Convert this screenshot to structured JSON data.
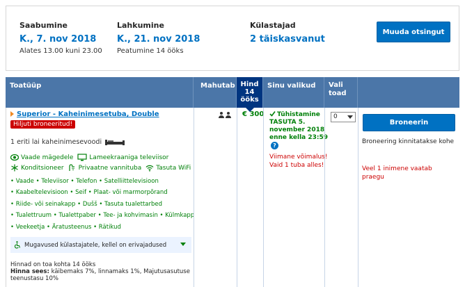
{
  "summary": {
    "checkin_label": "Saabumine",
    "checkin_value": "K., 7. nov 2018",
    "checkin_sub": "Alates 13.00 kuni 23.00",
    "checkout_label": "Lahkumine",
    "checkout_value": "K., 21. nov 2018",
    "checkout_sub": "Peatumine 14 ööks",
    "guests_label": "Külastajad",
    "guests_value": "2 täiskasvanut",
    "modify_button": "Muuda otsingut"
  },
  "table": {
    "headers": {
      "room_type": "Toatüüp",
      "occupancy": "Mahutab",
      "price_line1": "Hind",
      "price_line2": "14",
      "price_line3": "ööks",
      "choices": "Sinu valikud",
      "select_line1": "Vali",
      "select_line2": "toad"
    },
    "room": {
      "name": "Superior - Kaheinimesetuba, Double",
      "badge": "Hiljuti broneeritud!",
      "bed": "1 eriti lai kaheinimesevoodi",
      "features_row1": [
        "Vaade mägedele",
        "Lameekraaniga televiisor"
      ],
      "features_row2": [
        "Konditsioneer",
        "Privaatne vannituba",
        "Tasuta WiFi"
      ],
      "amenity_rows": [
        "• Vaade  • Televiisor  • Telefon  • Satelliittelevisioon",
        "• Kaabeltelevisioon  • Seif  • Plaat- või marmorpõrand",
        "• Riide- või seinakapp  • Dušš  • Tasuta tualettarbed",
        "• Tualettruum  • Tualettpaber  • Tee- ja kohvimasin  • Külmkapp",
        "• Veekeetja  • Äratusteenus  • Rätikud"
      ],
      "accessibility": "Mugavused külastajatele, kellel on erivajadused",
      "price_note_line1": "Hinnad on toa kohta 14 ööks",
      "price_note_label": "Hinna sees:",
      "price_note_rest": " käibemaks 7%, linnamaks 1%, Majutusasutuse teenustasu 10%",
      "price": "€ 300",
      "cancellation": "Tühistamine TASUTA 5. november 2018 enne kella 23:59",
      "last_chance": "Viimane võimalus! Vaid 1 tuba alles!",
      "quantity": "0",
      "book_button": "Broneerin",
      "instant_confirm": "Broneering kinnitatakse kohe",
      "viewers": "Veel 1 inimene vaatab praegu"
    }
  },
  "colors": {
    "brand_blue": "#0071c2",
    "header_blue": "#4b76a8",
    "price_header": "#003580",
    "green": "#008009",
    "red": "#cc0000"
  }
}
